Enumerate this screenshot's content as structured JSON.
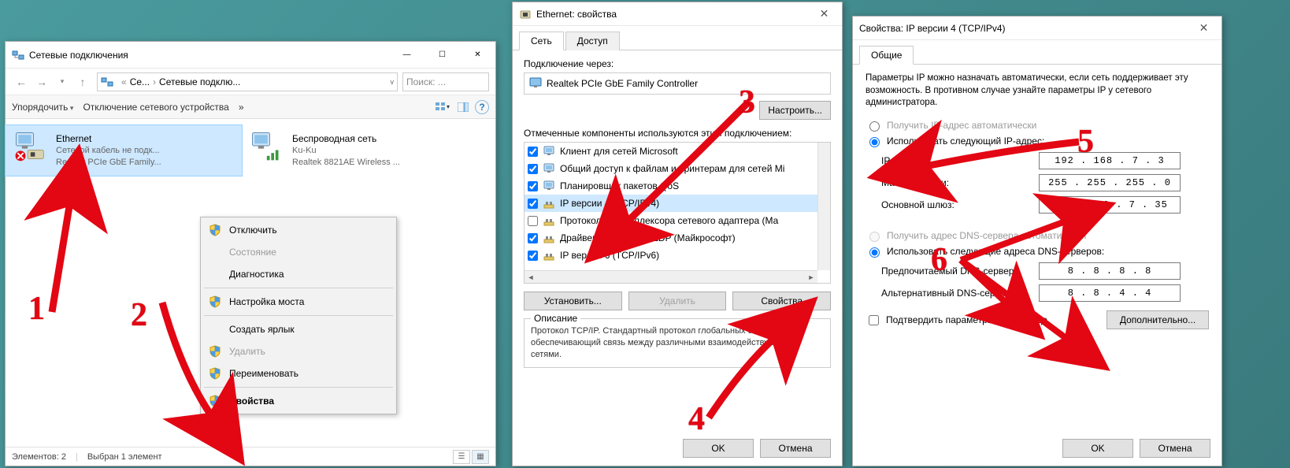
{
  "win1": {
    "title": "Сетевые подключения",
    "breadcrumb": {
      "part1": "Се...",
      "part2": "Сетевые подклю..."
    },
    "search_placeholder": "Поиск: ...",
    "toolbar": {
      "organize": "Упорядочить",
      "disable": "Отключение сетевого устройства",
      "more": "»"
    },
    "items": [
      {
        "name": "Ethernet",
        "line2": "Сетевой кабель не подк...",
        "line3": "Realtek PCIe GbE Family..."
      },
      {
        "name": "Беспроводная сеть",
        "line2": "Ku-Ku",
        "line3": "Realtek 8821AE Wireless ..."
      }
    ],
    "status": {
      "count_label": "Элементов: 2",
      "sel_label": "Выбран 1 элемент"
    }
  },
  "ctx": {
    "items": [
      {
        "label": "Отключить",
        "shield": true
      },
      {
        "label": "Состояние",
        "disabled": true
      },
      {
        "label": "Диагностика"
      },
      {
        "sep": true
      },
      {
        "label": "Настройка моста",
        "shield": true
      },
      {
        "sep": true
      },
      {
        "label": "Создать ярлык"
      },
      {
        "label": "Удалить",
        "shield": true,
        "disabled": true
      },
      {
        "label": "Переименовать",
        "shield": true
      },
      {
        "sep": true
      },
      {
        "label": "Свойства",
        "shield": true,
        "bold": true
      }
    ]
  },
  "win2": {
    "title": "Ethernet: свойства",
    "tabs": {
      "net": "Сеть",
      "access": "Доступ"
    },
    "connect_via": "Подключение через:",
    "adapter": "Realtek PCIe GbE Family Controller",
    "configure": "Настроить...",
    "components_label": "Отмеченные компоненты используются этим подключением:",
    "components": [
      {
        "checked": true,
        "label": "Клиент для сетей Microsoft"
      },
      {
        "checked": true,
        "label": "Общий доступ к файлам и принтерам для сетей Mi"
      },
      {
        "checked": true,
        "label": "Планировщик пакетов QoS"
      },
      {
        "checked": true,
        "label": "IP версии 4 (TCP/IPv4)",
        "selected": true
      },
      {
        "checked": false,
        "label": "Протокол мультиплексора сетевого адаптера (Ма"
      },
      {
        "checked": true,
        "label": "Драйвер протокола LLDP (Майкрософт)"
      },
      {
        "checked": true,
        "label": "IP версии 6 (TCP/IPv6)"
      }
    ],
    "btn_install": "Установить...",
    "btn_remove": "Удалить",
    "btn_props": "Свойства",
    "desc_title": "Описание",
    "desc_text": "Протокол TCP/IP. Стандартный протокол глобальных сетей, обеспечивающий связь между различными взаимодействующими сетями.",
    "ok": "OK",
    "cancel": "Отмена"
  },
  "win3": {
    "title": "Свойства: IP версии 4 (TCP/IPv4)",
    "tab_general": "Общие",
    "intro": "Параметры IP можно назначать автоматически, если сеть поддерживает эту возможность. В противном случае узнайте параметры IP у сетевого администратора.",
    "radio_auto_ip": "Получить IP-адрес автоматически",
    "radio_manual_ip": "Использовать следующий IP-адрес:",
    "ip_label": "IP-адрес:",
    "ip_value": "192 . 168 .  7  .  3",
    "mask_label": "Маска подсети:",
    "mask_value": "255 . 255 . 255 .  0",
    "gw_label": "Основной шлюз:",
    "gw_value": "192 . 168 .  7  . 35",
    "radio_auto_dns": "Получить адрес DNS-сервера автоматически",
    "radio_manual_dns": "Использовать следующие адреса DNS-серверов:",
    "dns1_label": "Предпочитаемый DNS-сервер:",
    "dns1_value": "8  .  8  .  8  .  8",
    "dns2_label": "Альтернативный DNS-сервер:",
    "dns2_value": "8  .  8  .  4  .  4",
    "chk_validate": "Подтвердить параметры при выходе",
    "advanced": "Дополнительно...",
    "ok": "OK",
    "cancel": "Отмена"
  },
  "annotations": {
    "n1": "1",
    "n2": "2",
    "n3": "3",
    "n4": "4",
    "n5": "5",
    "n6": "6"
  }
}
